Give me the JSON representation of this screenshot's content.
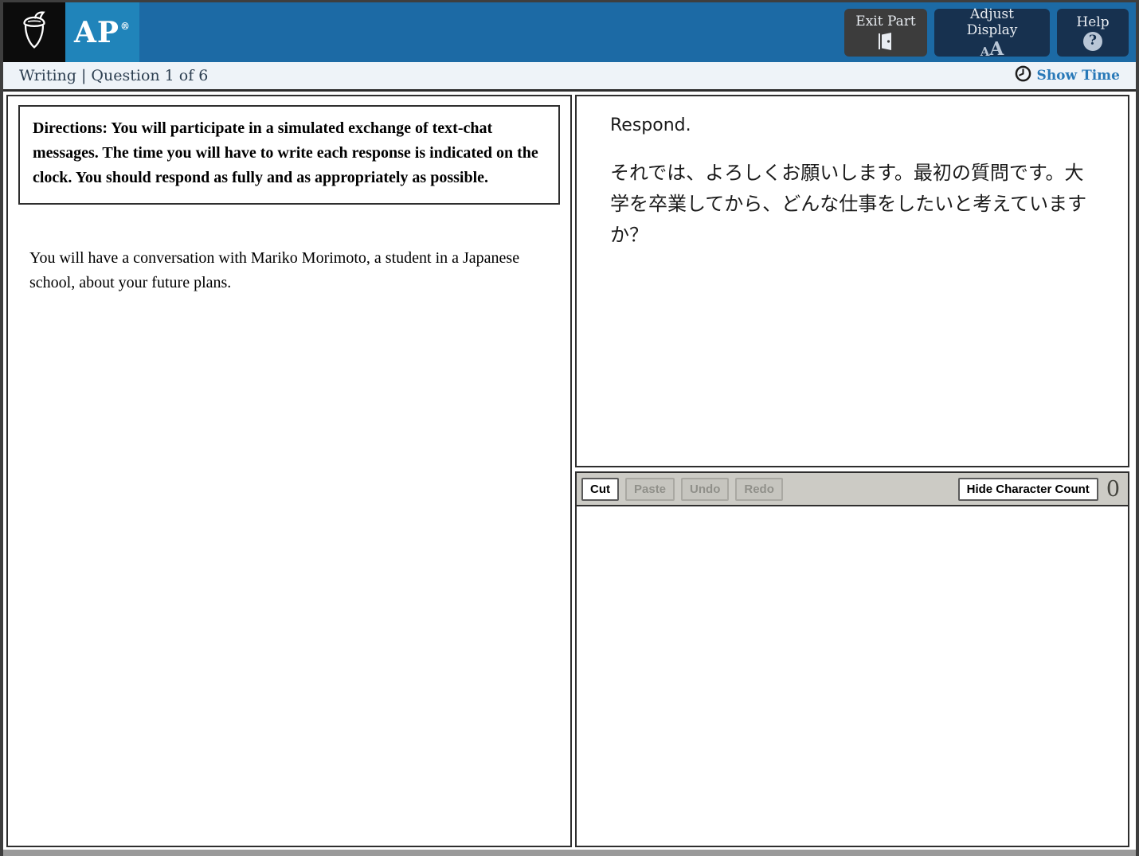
{
  "header": {
    "ap_logo_text": "AP",
    "ap_reg_mark": "®",
    "exit_part_label": "Exit Part",
    "adjust_display_label": "Adjust Display",
    "adjust_display_icon_small": "A",
    "adjust_display_icon_large": "A",
    "help_label": "Help",
    "help_icon_glyph": "?"
  },
  "status_bar": {
    "section_label": "Writing | Question 1 of 6",
    "show_time_label": "Show Time"
  },
  "left_panel": {
    "directions": "Directions: You will participate in a simulated exchange of text-chat messages. The time you will have to write each response is indicated on the clock. You should respond as fully and as appropriately as possible.",
    "scenario": "You will have a conversation with Mariko Morimoto, a student in a Japanese school, about your future plans."
  },
  "right_panel": {
    "prompt_title": "Respond.",
    "prompt_text": "それでは、よろしくお願いします。最初の質問です。大学を卒業してから、どんな仕事をしたいと考えていますか？",
    "toolbar": {
      "cut_label": "Cut",
      "paste_label": "Paste",
      "undo_label": "Undo",
      "redo_label": "Redo",
      "hide_character_count_label": "Hide Character Count",
      "character_count": "0"
    },
    "response_value": "",
    "response_placeholder": ""
  },
  "colors": {
    "header_blue": "#1c6aa5",
    "ap_square_blue": "#2084ba",
    "logo_black": "#0c0c0c",
    "navy_button": "#17314f",
    "exit_button_gray": "#3c3c3c",
    "status_bar_bg": "#eef3f8",
    "show_time_blue": "#2979b8",
    "panel_border": "#2e2e2e",
    "toolbar_gray": "#cccbc5",
    "disabled_text": "#90908a"
  }
}
